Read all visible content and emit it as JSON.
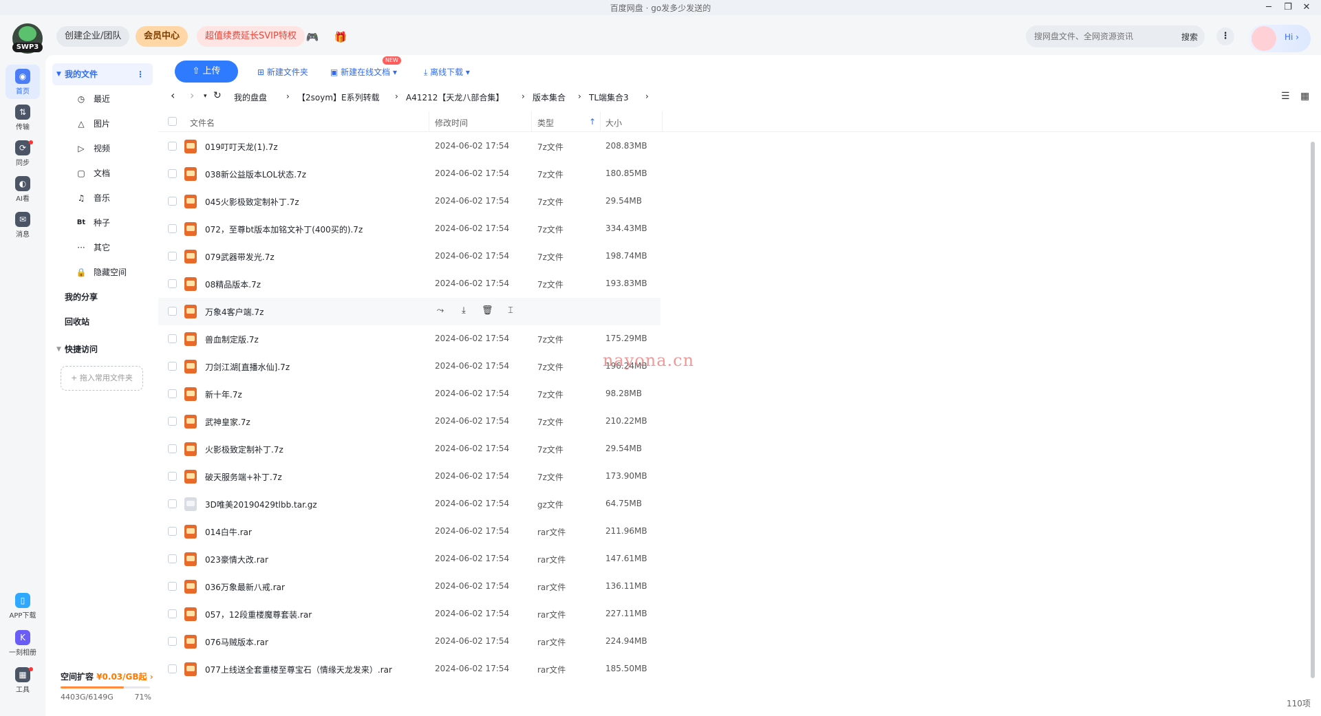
{
  "window": {
    "title": "百度网盘 · go发多少发送的",
    "min": "─",
    "max": "❐",
    "close": "✕"
  },
  "topbar": {
    "logo_text": "SWP3",
    "team": "创建企业/团队",
    "vip": "会员中心",
    "svip": "超值续费延长SVIP特权",
    "game_icon": "🎮",
    "gift_icon": "🎁",
    "search_placeholder": "搜网盘文件、全网资源资讯",
    "search_btn": "搜索",
    "more": "⋮",
    "hi": "Hi ›"
  },
  "leftnav": [
    {
      "label": "首页",
      "icon": "◉"
    },
    {
      "label": "传输",
      "icon": "⇅"
    },
    {
      "label": "同步",
      "icon": "⟳"
    },
    {
      "label": "AI看",
      "icon": "◐"
    },
    {
      "label": "消息",
      "icon": "✉"
    },
    {
      "label": "APP下载",
      "icon": "▯"
    },
    {
      "label": "一刻相册",
      "icon": "K"
    },
    {
      "label": "工具",
      "icon": "▦"
    }
  ],
  "sidebar": {
    "my_files": "我的文件",
    "items": [
      {
        "label": "最近",
        "icon": "◷"
      },
      {
        "label": "图片",
        "icon": "△"
      },
      {
        "label": "视频",
        "icon": "▷"
      },
      {
        "label": "文档",
        "icon": "▢"
      },
      {
        "label": "音乐",
        "icon": "♫"
      },
      {
        "label": "种子",
        "icon": "Bt"
      },
      {
        "label": "其它",
        "icon": "···"
      },
      {
        "label": "隐藏空间",
        "icon": "🔒"
      }
    ],
    "my_share": "我的分享",
    "recycle": "回收站",
    "quick": "快捷访问",
    "add_quick": "+ 拖入常用文件夹",
    "storage": {
      "label": "空间扩容",
      "promo": "¥0.03/GB起 ›",
      "used": "4403G/6149G",
      "percent": "71%",
      "fraction": 0.71
    }
  },
  "toolbar": {
    "upload": "⇧ 上传",
    "new_folder": "⊞ 新建文件夹",
    "new_doc": "▣ 新建在线文档 ▾",
    "new_badge": "NEW",
    "offline": "⤓ 离线下载 ▾"
  },
  "breadcrumb": [
    "我的盘盘",
    "【2soym】E系列转载",
    "A41212【天龙八部合集】",
    "版本集合",
    "TL端集合3"
  ],
  "nav": {
    "back": "‹",
    "forward": "›",
    "down": "▾",
    "refresh": "↻",
    "sep": "›"
  },
  "view": {
    "sort": "☰",
    "grid": "▦"
  },
  "table": {
    "headers": {
      "name": "文件名",
      "date": "修改时间",
      "type": "类型",
      "size": "大小",
      "sort_arrow": "↑"
    },
    "rows": [
      {
        "name": "019叮叮天龙(1).7z",
        "date": "2024-06-02 17:54",
        "type": "7z文件",
        "size": "208.83MB",
        "kind": "7z"
      },
      {
        "name": "038新公益版本LOL状态.7z",
        "date": "2024-06-02 17:54",
        "type": "7z文件",
        "size": "180.85MB",
        "kind": "7z"
      },
      {
        "name": "045火影极致定制补丁.7z",
        "date": "2024-06-02 17:54",
        "type": "7z文件",
        "size": "29.54MB",
        "kind": "7z"
      },
      {
        "name": "072，至尊bt版本加铭文补丁(400买的).7z",
        "date": "2024-06-02 17:54",
        "type": "7z文件",
        "size": "334.43MB",
        "kind": "7z"
      },
      {
        "name": "079武器带发光.7z",
        "date": "2024-06-02 17:54",
        "type": "7z文件",
        "size": "198.74MB",
        "kind": "7z"
      },
      {
        "name": "08精品版本.7z",
        "date": "2024-06-02 17:54",
        "type": "7z文件",
        "size": "193.83MB",
        "kind": "7z"
      },
      {
        "name": "万象4客户端.7z",
        "date": "",
        "type": "",
        "size": "",
        "kind": "7z",
        "hover": true
      },
      {
        "name": "兽血制定版.7z",
        "date": "2024-06-02 17:54",
        "type": "7z文件",
        "size": "175.29MB",
        "kind": "7z"
      },
      {
        "name": "刀剑江湖[直播水仙].7z",
        "date": "2024-06-02 17:54",
        "type": "7z文件",
        "size": "196.24MB",
        "kind": "7z"
      },
      {
        "name": "新十年.7z",
        "date": "2024-06-02 17:54",
        "type": "7z文件",
        "size": "98.28MB",
        "kind": "7z"
      },
      {
        "name": "武神皇家.7z",
        "date": "2024-06-02 17:54",
        "type": "7z文件",
        "size": "210.22MB",
        "kind": "7z"
      },
      {
        "name": "火影极致定制补丁.7z",
        "date": "2024-06-02 17:54",
        "type": "7z文件",
        "size": "29.54MB",
        "kind": "7z"
      },
      {
        "name": "破天服务端+补丁.7z",
        "date": "2024-06-02 17:54",
        "type": "7z文件",
        "size": "173.90MB",
        "kind": "7z"
      },
      {
        "name": "3D唯美20190429tlbb.tar.gz",
        "date": "2024-06-02 17:54",
        "type": "gz文件",
        "size": "64.75MB",
        "kind": "gz"
      },
      {
        "name": "014白牛.rar",
        "date": "2024-06-02 17:54",
        "type": "rar文件",
        "size": "211.96MB",
        "kind": "rar"
      },
      {
        "name": "023豪情大改.rar",
        "date": "2024-06-02 17:54",
        "type": "rar文件",
        "size": "147.61MB",
        "kind": "rar"
      },
      {
        "name": "036万象最新八戒.rar",
        "date": "2024-06-02 17:54",
        "type": "rar文件",
        "size": "136.11MB",
        "kind": "rar"
      },
      {
        "name": "057，12段重楼魔尊套装.rar",
        "date": "2024-06-02 17:54",
        "type": "rar文件",
        "size": "227.11MB",
        "kind": "rar"
      },
      {
        "name": "076马贼版本.rar",
        "date": "2024-06-02 17:54",
        "type": "rar文件",
        "size": "224.94MB",
        "kind": "rar"
      },
      {
        "name": "077上线送全套重楼至尊宝石（情缘天龙发来）.rar",
        "date": "2024-06-02 17:54",
        "type": "rar文件",
        "size": "185.50MB",
        "kind": "rar"
      }
    ],
    "row_actions": {
      "share": "⤳",
      "download": "⤓",
      "delete": "🗑",
      "rename": "⌶"
    }
  },
  "watermark": "nayona.cn",
  "footer": {
    "count": "110项"
  }
}
